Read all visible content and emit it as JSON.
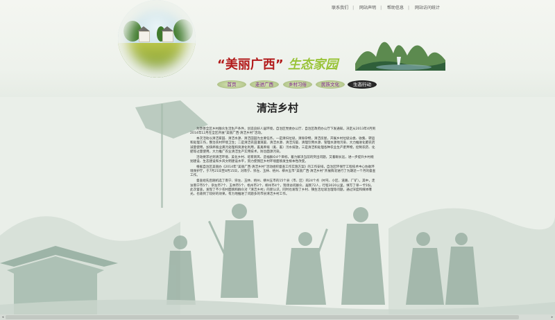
{
  "top_links": [
    "联系我们",
    "网站声明",
    "帮助信息",
    "网站访问统计"
  ],
  "banner": {
    "title_quoted": "“美丽广西”",
    "title_green": "生态家园"
  },
  "nav": {
    "items": [
      "首页",
      "走进广西",
      "乡村习俗",
      "民族文化",
      "生态行动"
    ],
    "active_index": 4
  },
  "article": {
    "title": "清洁乡村",
    "paragraphs": [
      "为改善全区乡村群众生活生产条件，创造良好人居环境，自治区党委办公厅、自治区政府办公厅下发通知，决定从2013年4月到2014年12月在全区开展“美丽广西·清洁乡村”活动。",
      "本次活动以清洁家园、清洁水源、清洁田园为主要任务，一是清扫垃圾，清除杂物，清洁房屋，开展乡村垃圾分类、收集、转运和处理工作，整治农村环境卫生；二是清洁农田灌溉渠、清洁水源、清洁沟渠、清理饮用水源、管理水源地污染、大力推进化肥农药减量使用，加快养殖业粪污处理和资源化利用，畜禽养殖（禽、畜）污水排放，三是清洁和处理各种农业生产废弃物，控制农药、化肥等过量使用，大力推广农业清洁生产实用技术，防治面源污染。",
      "活动要求达到清洁环境、美化乡村、培育新风、造福群众4个目标，着力解决当前的突出问题，又着眼长远，进一步提升乡村规划建设、生态建设和乡风文明建设水平，努力使我区乡村环境面貌发生根本性改变。",
      "根据自治区美丽办《2014年“美丽广西·清洁乡村”活动组织督查工作实施方案》的工作安排，自治区环保厅工程技术中心协助环境保护厅，于7月21日至8月15日，对南宁、崇左、玉林、梧州、柳州五市“美丽广西·清洁乡村”开展情况进行了为期近一个月的督查工作。",
      "督查组先后随机选了南宁、崇左、玉林、梧州、柳州五市的15个县（市、区）的24个点（村屯、小区、道路、厂矿），其中，走访南宁市5个、崇左市7个、玉林市5个、梧州市3个、柳州市4个，现场访问群众、居民72人，行程3020公里，填写了单一卡5份。此次督查，发现了不少农村面貌和群众对「清洁乡村」的新认识，同时也发现了乡村、镇生活垃圾治理等问题，通过深度和媒体曝光，也收到了较好的效果，有力地推进了问题多的市县清洁乡村工作。"
    ]
  },
  "colors": {
    "title_red": "#b21a1a",
    "title_green": "#9ac43a",
    "nav_text": "#7a1f8c",
    "background": "#eaefe9"
  }
}
